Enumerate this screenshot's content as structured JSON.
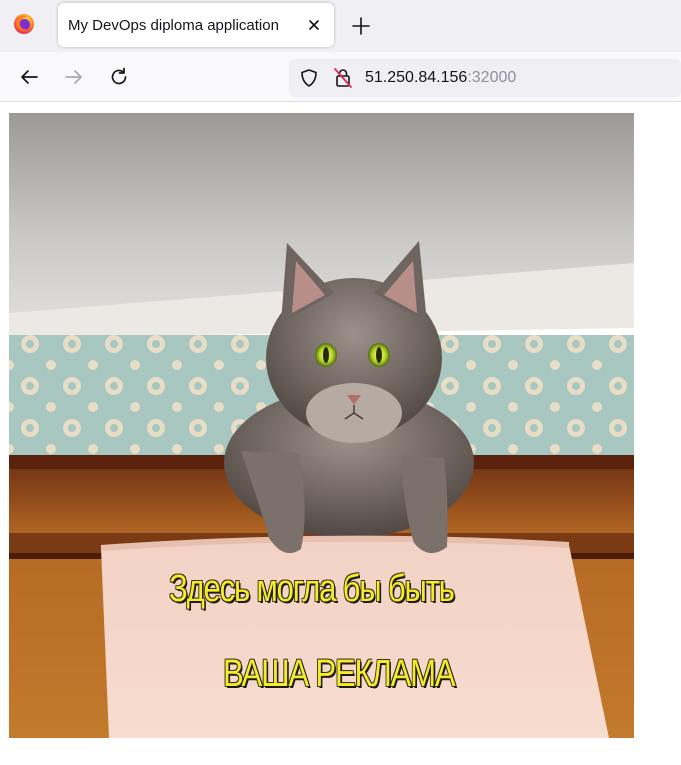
{
  "browser": {
    "tab": {
      "title": "My DevOps diploma application"
    },
    "address": {
      "host": "51.250.84.156",
      "port": ":32000"
    },
    "icons": {
      "app": "firefox-icon",
      "close": "close-icon",
      "new_tab": "plus-icon",
      "back": "arrow-left-icon",
      "forward": "arrow-right-icon",
      "reload": "reload-icon",
      "tracking": "shield-icon",
      "insecure": "insecure-lock-icon"
    }
  },
  "page": {
    "image": {
      "subject": "cat",
      "caption_line1": "Здесь могла бы быть",
      "caption_line2": "ВАША РЕКЛАМА",
      "caption_color": "#f4ec2a"
    }
  }
}
